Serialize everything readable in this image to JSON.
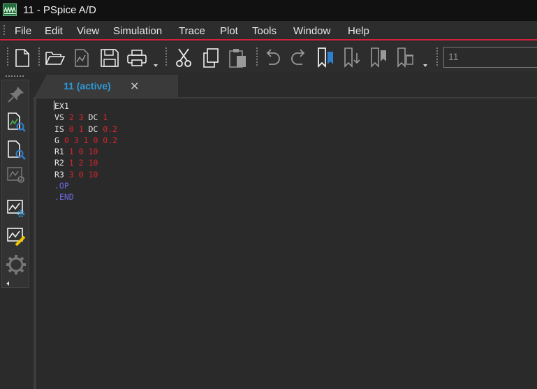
{
  "window": {
    "title": "11 - PSpice A/D"
  },
  "menu": [
    "File",
    "Edit",
    "View",
    "Simulation",
    "Trace",
    "Plot",
    "Tools",
    "Window",
    "Help"
  ],
  "toolbar": {
    "buttons": [
      "new-document",
      "open-folder",
      "new-plot",
      "save",
      "print",
      "cut",
      "copy",
      "paste",
      "undo",
      "redo",
      "bookmark-toggle",
      "bookmark-next",
      "bookmark-prev",
      "bookmark-clear"
    ],
    "combo_value": "11"
  },
  "sidebar": {
    "buttons": [
      "pin",
      "run-sim-settings",
      "view-simulation-results",
      "view-output-file",
      "simulation-settings",
      "edit-trace",
      "run"
    ]
  },
  "tab": {
    "label": "11 (active)",
    "close": "×"
  },
  "editor": {
    "lines": [
      [
        {
          "t": "EX1",
          "c": "w"
        }
      ],
      [
        {
          "t": "VS ",
          "c": "w"
        },
        {
          "t": "2 3 ",
          "c": "r"
        },
        {
          "t": "DC ",
          "c": "w"
        },
        {
          "t": "1",
          "c": "r"
        }
      ],
      [
        {
          "t": "IS ",
          "c": "w"
        },
        {
          "t": "0 1 ",
          "c": "r"
        },
        {
          "t": "DC ",
          "c": "w"
        },
        {
          "t": "0.2",
          "c": "r"
        }
      ],
      [
        {
          "t": "G ",
          "c": "w"
        },
        {
          "t": "0 3 1 0 0.2",
          "c": "r"
        }
      ],
      [
        {
          "t": "R1 ",
          "c": "w"
        },
        {
          "t": "1 0 10",
          "c": "r"
        }
      ],
      [
        {
          "t": "R2 ",
          "c": "w"
        },
        {
          "t": "1 2 10",
          "c": "r"
        }
      ],
      [
        {
          "t": "R3 ",
          "c": "w"
        },
        {
          "t": "3 0 10",
          "c": "r"
        }
      ],
      [
        {
          "t": ".OP",
          "c": "b"
        }
      ],
      [
        {
          "t": ".END",
          "c": "b"
        }
      ]
    ]
  },
  "colors": {
    "accent_red": "#d0223f",
    "tab_blue": "#2e9ad8",
    "number_red": "#d9262b",
    "directive_blue": "#6a6ae0"
  }
}
